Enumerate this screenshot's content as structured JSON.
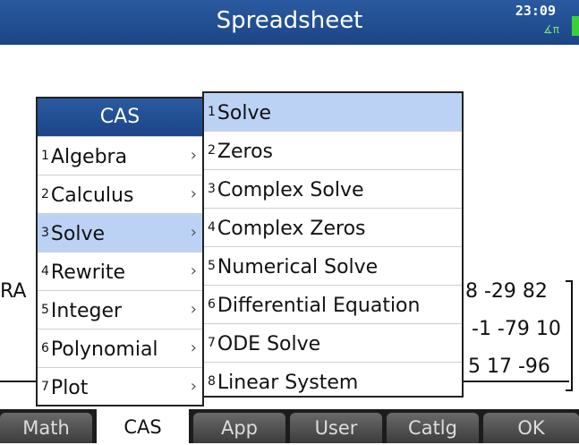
{
  "titlebar": {
    "title": "Spreadsheet",
    "clock": "23:09",
    "angle_mode": "∡π"
  },
  "background": {
    "label_prefix": "RA",
    "matrix_rows": [
      "8 -29 82",
      "-1 -79 10",
      "5 17 -96"
    ]
  },
  "cas_menu": {
    "title": "CAS",
    "items": [
      {
        "num": "1",
        "label": "Algebra",
        "arrow": "›"
      },
      {
        "num": "2",
        "label": "Calculus",
        "arrow": "›"
      },
      {
        "num": "3",
        "label": "Solve",
        "arrow": "›"
      },
      {
        "num": "4",
        "label": "Rewrite",
        "arrow": "›"
      },
      {
        "num": "5",
        "label": "Integer",
        "arrow": "›"
      },
      {
        "num": "6",
        "label": "Polynomial",
        "arrow": "›"
      },
      {
        "num": "7",
        "label": "Plot",
        "arrow": "›"
      }
    ]
  },
  "solve_menu": {
    "items": [
      {
        "num": "1",
        "label": "Solve"
      },
      {
        "num": "2",
        "label": "Zeros"
      },
      {
        "num": "3",
        "label": "Complex Solve"
      },
      {
        "num": "4",
        "label": "Complex Zeros"
      },
      {
        "num": "5",
        "label": "Numerical Solve"
      },
      {
        "num": "6",
        "label": "Differential Equation"
      },
      {
        "num": "7",
        "label": "ODE Solve"
      },
      {
        "num": "8",
        "label": "Linear System"
      }
    ]
  },
  "softkeys": [
    "Math",
    "CAS",
    "App",
    "User",
    "Catlg",
    "OK"
  ]
}
